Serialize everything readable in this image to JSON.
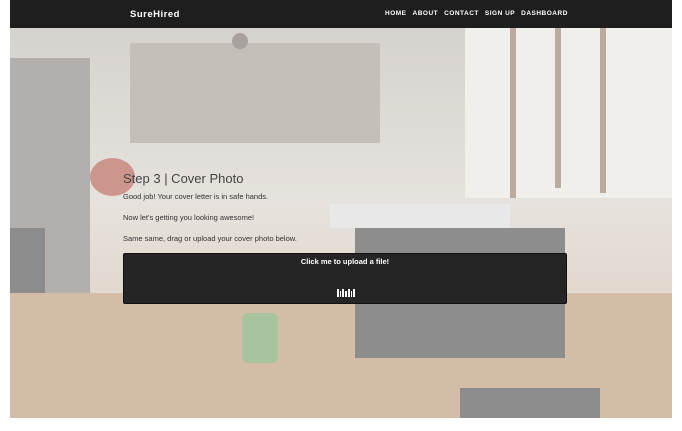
{
  "navbar": {
    "brand": "SureHired",
    "links": [
      "HOME",
      "ABOUT",
      "CONTACT",
      "SIGN UP",
      "DASHBOARD"
    ]
  },
  "step": {
    "title": "Step 3 | Cover Photo",
    "line1": "Good job! Your cover letter is in safe hands.",
    "line2": "Now let's getting you looking awesome!",
    "line3": "Same same, drag or upload your cover photo below."
  },
  "upload": {
    "label": "Click me to upload a file!",
    "icon": "upload-bars-icon"
  }
}
